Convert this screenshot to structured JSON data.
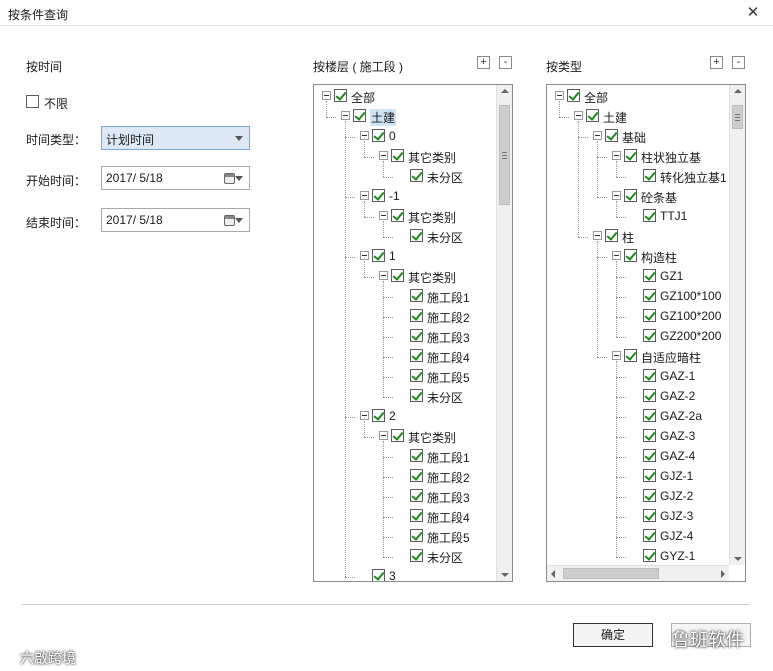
{
  "window": {
    "title": "按条件查询"
  },
  "left": {
    "section_title": "按时间",
    "unlimited_label": "不限",
    "time_type_label": "时间类型：",
    "time_type_value": "计划时间",
    "start_label": "开始时间：",
    "start_value": "2017/  5/18",
    "end_label": "结束时间：",
    "end_value": "2017/  5/18"
  },
  "floor": {
    "title": "按楼层 ( 施工段 )",
    "tree": [
      {
        "label": "全部",
        "level": 0
      },
      {
        "label": "土建",
        "level": 1,
        "highlight": true
      },
      {
        "label": "0",
        "level": 2
      },
      {
        "label": "其它类别",
        "level": 3
      },
      {
        "label": "未分区",
        "level": 4
      },
      {
        "label": "-1",
        "level": 2
      },
      {
        "label": "其它类别",
        "level": 3
      },
      {
        "label": "未分区",
        "level": 4
      },
      {
        "label": "1",
        "level": 2
      },
      {
        "label": "其它类别",
        "level": 3
      },
      {
        "label": "施工段1",
        "level": 4
      },
      {
        "label": "施工段2",
        "level": 4
      },
      {
        "label": "施工段3",
        "level": 4
      },
      {
        "label": "施工段4",
        "level": 4
      },
      {
        "label": "施工段5",
        "level": 4
      },
      {
        "label": "未分区",
        "level": 4
      },
      {
        "label": "2",
        "level": 2
      },
      {
        "label": "其它类别",
        "level": 3
      },
      {
        "label": "施工段1",
        "level": 4
      },
      {
        "label": "施工段2",
        "level": 4
      },
      {
        "label": "施工段3",
        "level": 4
      },
      {
        "label": "施工段4",
        "level": 4
      },
      {
        "label": "施工段5",
        "level": 4
      },
      {
        "label": "未分区",
        "level": 4
      },
      {
        "label": "3",
        "level": 2
      }
    ]
  },
  "type": {
    "title": "按类型",
    "tree": [
      {
        "label": "全部",
        "level": 0
      },
      {
        "label": "土建",
        "level": 1
      },
      {
        "label": "基础",
        "level": 2
      },
      {
        "label": "柱状独立基",
        "level": 3
      },
      {
        "label": "转化独立基1",
        "level": 4
      },
      {
        "label": "砼条基",
        "level": 3
      },
      {
        "label": "TTJ1",
        "level": 4
      },
      {
        "label": "柱",
        "level": 2
      },
      {
        "label": "构造柱",
        "level": 3
      },
      {
        "label": "GZ1",
        "level": 4
      },
      {
        "label": "GZ100*100",
        "level": 4
      },
      {
        "label": "GZ100*200",
        "level": 4
      },
      {
        "label": "GZ200*200",
        "level": 4
      },
      {
        "label": "自适应暗柱",
        "level": 3
      },
      {
        "label": "GAZ-1",
        "level": 4
      },
      {
        "label": "GAZ-2",
        "level": 4
      },
      {
        "label": "GAZ-2a",
        "level": 4
      },
      {
        "label": "GAZ-3",
        "level": 4
      },
      {
        "label": "GAZ-4",
        "level": 4
      },
      {
        "label": "GJZ-1",
        "level": 4
      },
      {
        "label": "GJZ-2",
        "level": 4
      },
      {
        "label": "GJZ-3",
        "level": 4
      },
      {
        "label": "GJZ-4",
        "level": 4
      },
      {
        "label": "GYZ-1",
        "level": 4
      }
    ]
  },
  "footer": {
    "ok_label": "确定"
  },
  "watermarks": {
    "left": "六啟跨境",
    "right": "鲁班软件"
  },
  "colors": {
    "check": "#1b8a1b",
    "highlight": "#cfe3f7",
    "select_bg": "#dce8f6"
  }
}
